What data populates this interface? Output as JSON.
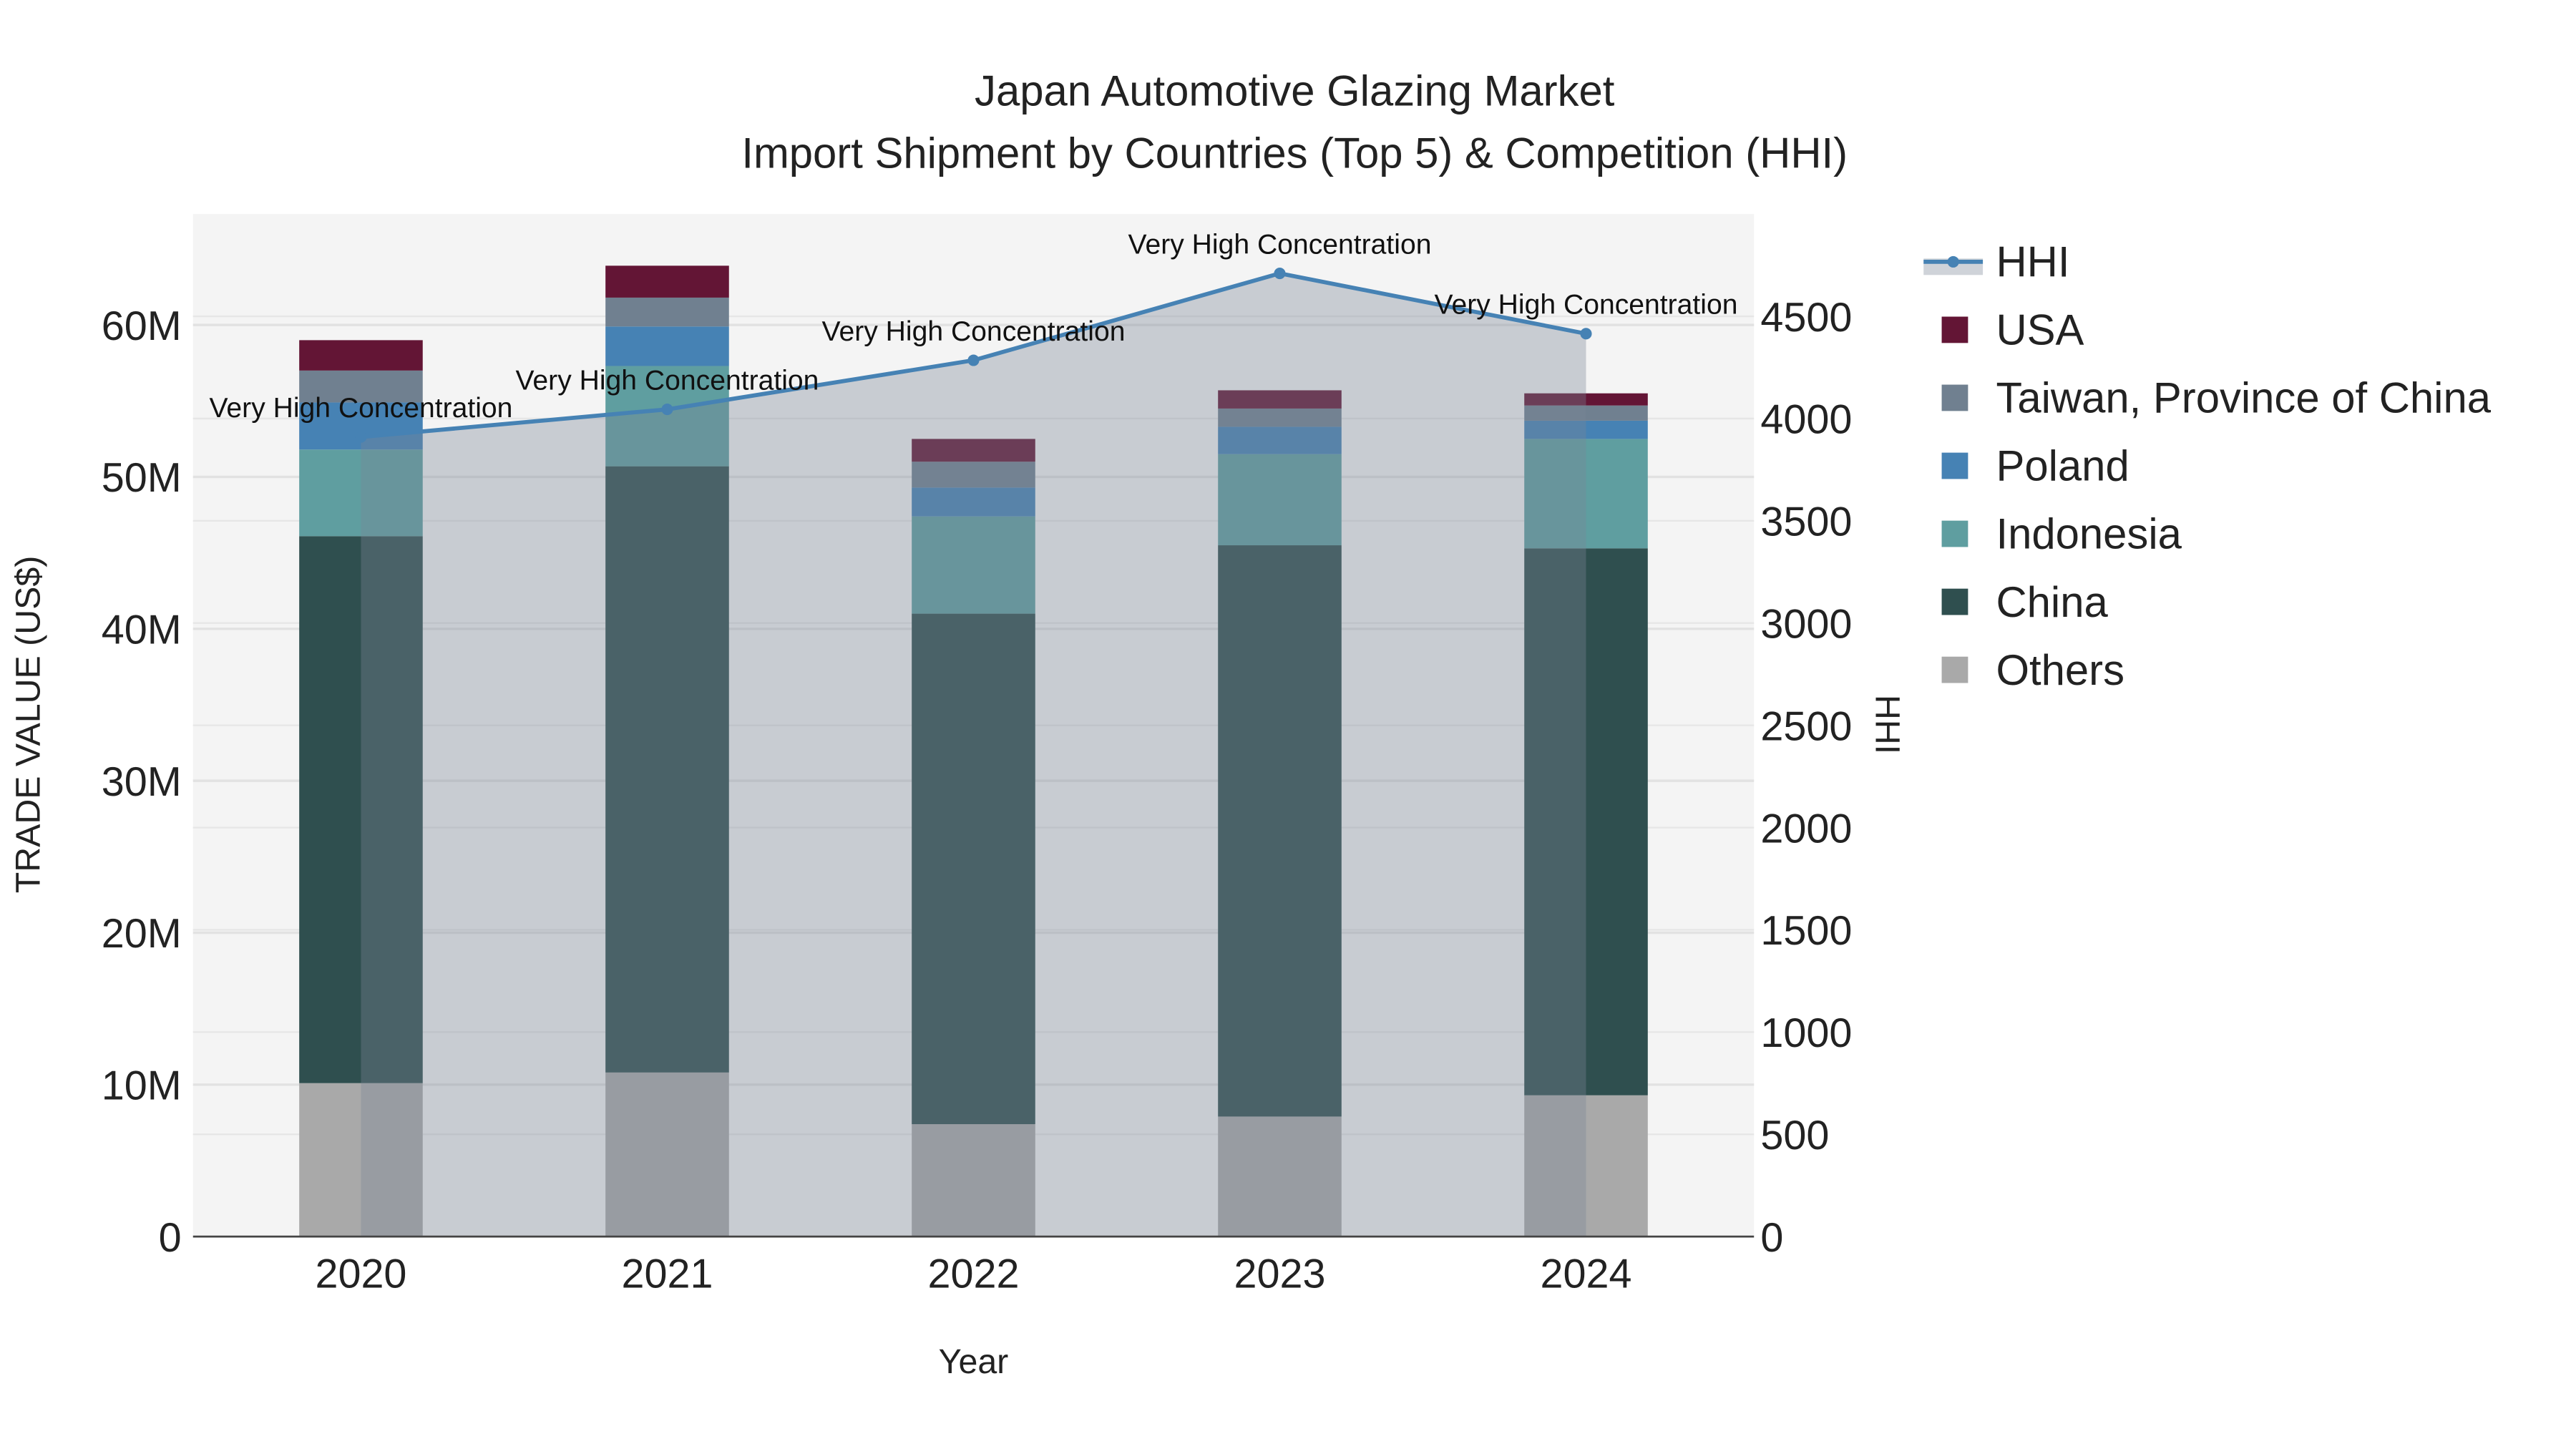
{
  "chart_data": {
    "type": "bar",
    "title": "Japan Automotive Glazing Market",
    "subtitle": "Import Shipment by Countries (Top 5) & Competition (HHI)",
    "xlabel": "Year",
    "ylabel": "TRADE VALUE (US$)",
    "y2label": "HHI",
    "categories": [
      "2020",
      "2021",
      "2022",
      "2023",
      "2024"
    ],
    "ylim": [
      0,
      67300000
    ],
    "y2lim": [
      0,
      5000
    ],
    "yticks": [
      {
        "v": 0,
        "label": "0"
      },
      {
        "v": 10000000,
        "label": "10M"
      },
      {
        "v": 20000000,
        "label": "20M"
      },
      {
        "v": 30000000,
        "label": "30M"
      },
      {
        "v": 40000000,
        "label": "40M"
      },
      {
        "v": 50000000,
        "label": "50M"
      },
      {
        "v": 60000000,
        "label": "60M"
      }
    ],
    "y2ticks": [
      0,
      500,
      1000,
      1500,
      2000,
      2500,
      3000,
      3500,
      4000,
      4500
    ],
    "stacked": true,
    "series": [
      {
        "name": "Others",
        "color": "#A9A9A9",
        "values": [
          10100000,
          10800000,
          7400000,
          7900000,
          9300000
        ]
      },
      {
        "name": "China",
        "color": "#2F4F4F",
        "values": [
          36000000,
          39900000,
          33600000,
          37600000,
          36000000
        ]
      },
      {
        "name": "Indonesia",
        "color": "#5F9EA0",
        "values": [
          5700000,
          6600000,
          6400000,
          6000000,
          7200000
        ]
      },
      {
        "name": "Poland",
        "color": "#4682B4",
        "values": [
          3100000,
          2600000,
          1900000,
          1800000,
          1200000
        ]
      },
      {
        "name": "Taiwan, Province of China",
        "color": "#708090",
        "values": [
          2100000,
          1900000,
          1700000,
          1200000,
          1000000
        ]
      },
      {
        "name": "USA",
        "color": "#631535",
        "values": [
          2000000,
          2100000,
          1500000,
          1200000,
          800000
        ]
      }
    ],
    "line": {
      "name": "HHI",
      "color": "#4682B4",
      "values": [
        3910,
        4045,
        4285,
        4710,
        4415
      ],
      "annotations": [
        "Very High Concentration",
        "Very High Concentration",
        "Very High Concentration",
        "Very High Concentration",
        "Very High Concentration"
      ]
    },
    "legend_order": [
      "HHI",
      "USA",
      "Taiwan, Province of China",
      "Poland",
      "Indonesia",
      "China",
      "Others"
    ],
    "legend_placement": "right",
    "grid": true
  }
}
